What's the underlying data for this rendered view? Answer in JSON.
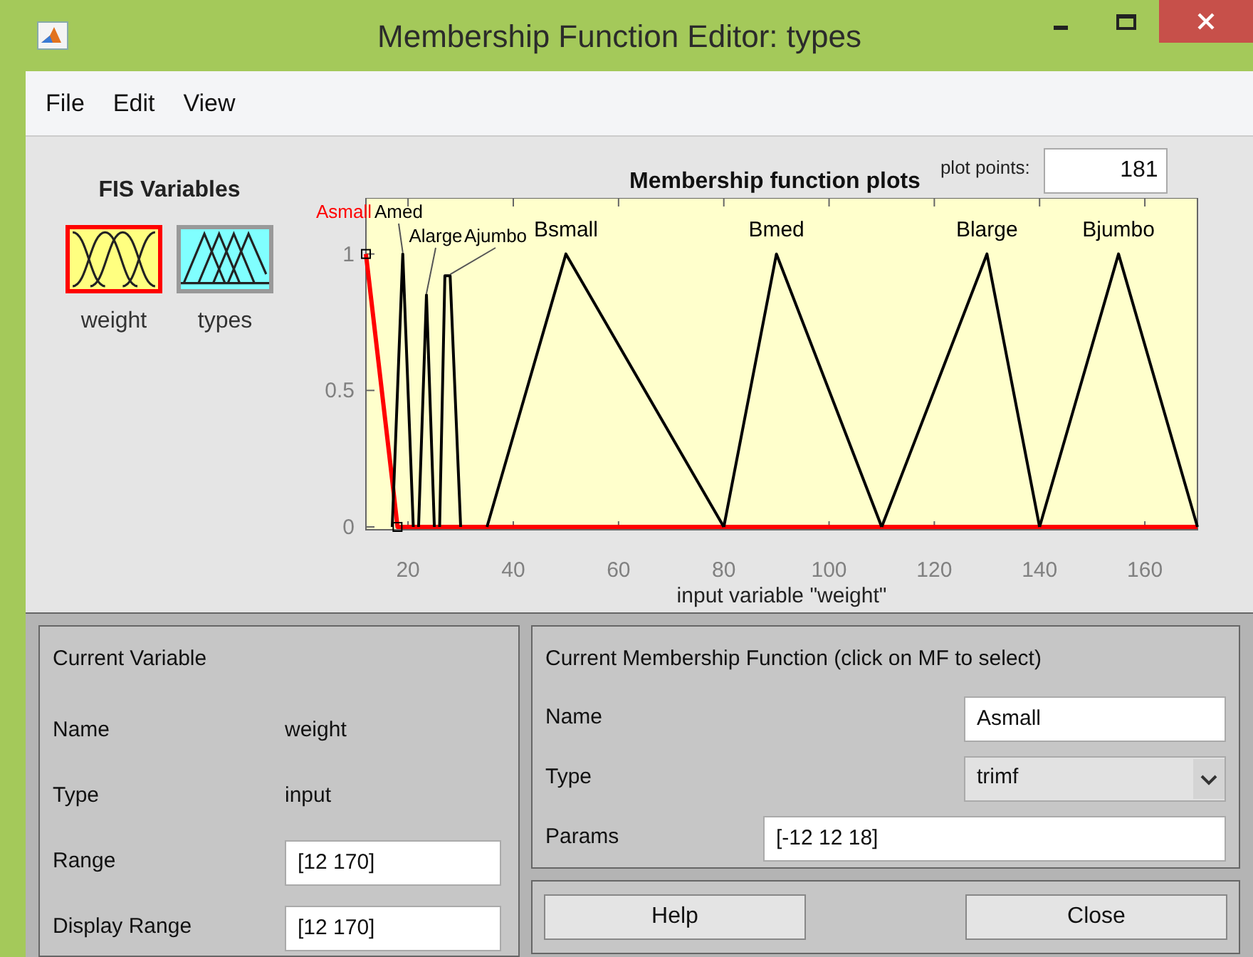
{
  "window": {
    "title": "Membership Function Editor: types"
  },
  "menu": [
    "File",
    "Edit",
    "View"
  ],
  "fis_variables": {
    "title": "FIS Variables",
    "items": [
      {
        "label": "weight",
        "kind": "input",
        "selected": true
      },
      {
        "label": "types",
        "kind": "output",
        "selected": false
      }
    ]
  },
  "plot": {
    "title": "Membership function plots",
    "plot_points_label": "plot points:",
    "plot_points": "181",
    "chart_data": {
      "type": "line",
      "xlabel": "input variable \"weight\"",
      "x": [
        12,
        17,
        18,
        19,
        21,
        22,
        23.5,
        25,
        26,
        27,
        28,
        30,
        35,
        50,
        80,
        90,
        110,
        130,
        140,
        155,
        170
      ],
      "series": [
        {
          "name": "Asmall",
          "color": "#ff0000",
          "values": [
            1,
            0.17,
            0,
            0,
            0,
            0,
            0,
            0,
            0,
            0,
            0,
            0,
            0,
            0,
            0,
            0,
            0,
            0,
            0,
            0,
            0
          ]
        },
        {
          "name": "Amed",
          "color": "#000000",
          "values": [
            null,
            0,
            0.5,
            1,
            0,
            null,
            null,
            null,
            null,
            null,
            null,
            null,
            null,
            null,
            null,
            null,
            null,
            null,
            null,
            null,
            null
          ]
        },
        {
          "name": "Alarge",
          "color": "#000000",
          "values": [
            null,
            null,
            null,
            null,
            null,
            0,
            0.85,
            0,
            null,
            null,
            null,
            null,
            null,
            null,
            null,
            null,
            null,
            null,
            null,
            null,
            null
          ]
        },
        {
          "name": "Ajumbo",
          "color": "#000000",
          "values": [
            null,
            null,
            null,
            null,
            null,
            null,
            null,
            null,
            0,
            0.92,
            0.92,
            0,
            null,
            null,
            null,
            null,
            null,
            null,
            null,
            null,
            null
          ]
        },
        {
          "name": "Bsmall",
          "color": "#000000",
          "values": [
            null,
            null,
            null,
            null,
            null,
            null,
            null,
            null,
            null,
            null,
            null,
            null,
            0,
            1,
            0,
            null,
            null,
            null,
            null,
            null,
            null
          ]
        },
        {
          "name": "Bmed",
          "color": "#000000",
          "values": [
            null,
            null,
            null,
            null,
            null,
            null,
            null,
            null,
            null,
            null,
            null,
            null,
            null,
            null,
            0,
            1,
            0,
            null,
            null,
            null,
            null
          ]
        },
        {
          "name": "Blarge",
          "color": "#000000",
          "values": [
            null,
            null,
            null,
            null,
            null,
            null,
            null,
            null,
            null,
            null,
            null,
            null,
            null,
            null,
            null,
            null,
            0,
            1,
            0,
            null,
            null
          ]
        },
        {
          "name": "Bjumbo",
          "color": "#000000",
          "values": [
            null,
            null,
            null,
            null,
            null,
            null,
            null,
            null,
            null,
            null,
            null,
            null,
            null,
            null,
            null,
            null,
            null,
            null,
            0,
            1,
            0
          ]
        }
      ],
      "xlim": [
        12,
        170
      ],
      "ylim": [
        0,
        1.2
      ],
      "xticks": [
        20,
        40,
        60,
        80,
        100,
        120,
        140,
        160
      ],
      "yticks": [
        0,
        0.5,
        1
      ]
    }
  },
  "current_variable": {
    "title": "Current Variable",
    "name_label": "Name",
    "name": "weight",
    "type_label": "Type",
    "type": "input",
    "range_label": "Range",
    "range": "[12 170]",
    "display_range_label": "Display Range",
    "display_range": "[12 170]"
  },
  "current_mf": {
    "title": "Current Membership Function (click on MF to select)",
    "name_label": "Name",
    "name": "Asmall",
    "type_label": "Type",
    "type": "trimf",
    "params_label": "Params",
    "params": "[-12 12 18]"
  },
  "buttons": [
    "Help",
    "Close"
  ]
}
